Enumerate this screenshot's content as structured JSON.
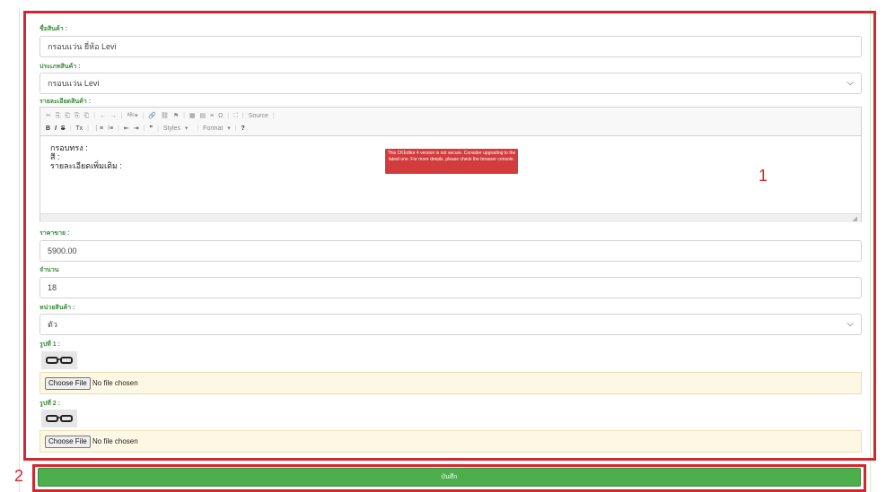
{
  "form": {
    "product_name": {
      "label": "ชื่อสินค้า :",
      "value": "กรอบแว่น ยี่ห้อ Levi"
    },
    "product_type": {
      "label": "ประเภทสินค้า :",
      "value": "กรอบแว่น Levi"
    },
    "details": {
      "label": "รายละเอียดสินค้า :",
      "toolbar_row1": [
        "✂",
        "⎘",
        "⎗",
        "⎘",
        "⎗",
        "←",
        "→",
        "ᴬᴮᶜ▾",
        "🔗",
        "⛓",
        "⚑",
        "▦",
        "▤",
        "≡",
        "Ω",
        "⛶",
        "Source"
      ],
      "toolbar_row2": [
        "B",
        "I",
        "S",
        "Tx",
        "⋮≡",
        "⁝≡",
        "⇤",
        "⇥",
        "❞",
        "Styles",
        "▾",
        "Format",
        "▾",
        "?"
      ],
      "lines": [
        "กรอบทรง :",
        "สี :",
        "รายละเอียดเพิ่มเติม :"
      ],
      "warning": "This CKEditor 4 version is not secure. Consider upgrading to the latest one. For more details, please check the browser console."
    },
    "price": {
      "label": "ราคาขาย :",
      "value": "5900.00"
    },
    "quantity": {
      "label": "จำนวน",
      "value": "18"
    },
    "unit": {
      "label": "หน่วยสินค้า :",
      "value": "ตัว"
    },
    "image1": {
      "label": "รูปที่ 1 :"
    },
    "image2": {
      "label": "รูปที่ 2 :"
    },
    "file_input": {
      "button": "Choose File",
      "status": "No file chosen"
    },
    "save_button": "บันทึก"
  },
  "annotations": {
    "box1": "1",
    "box2": "2"
  },
  "colors": {
    "annotation": "#d0282e",
    "label_green": "#3c8d3c",
    "save_green": "#4cae4c",
    "warning_red": "#d23c3c",
    "file_row_bg": "#fcf8e3"
  },
  "icons": {
    "select": "chevron-down-icon",
    "resize": "resize-handle-icon",
    "thumbnail": "glasses-image"
  }
}
